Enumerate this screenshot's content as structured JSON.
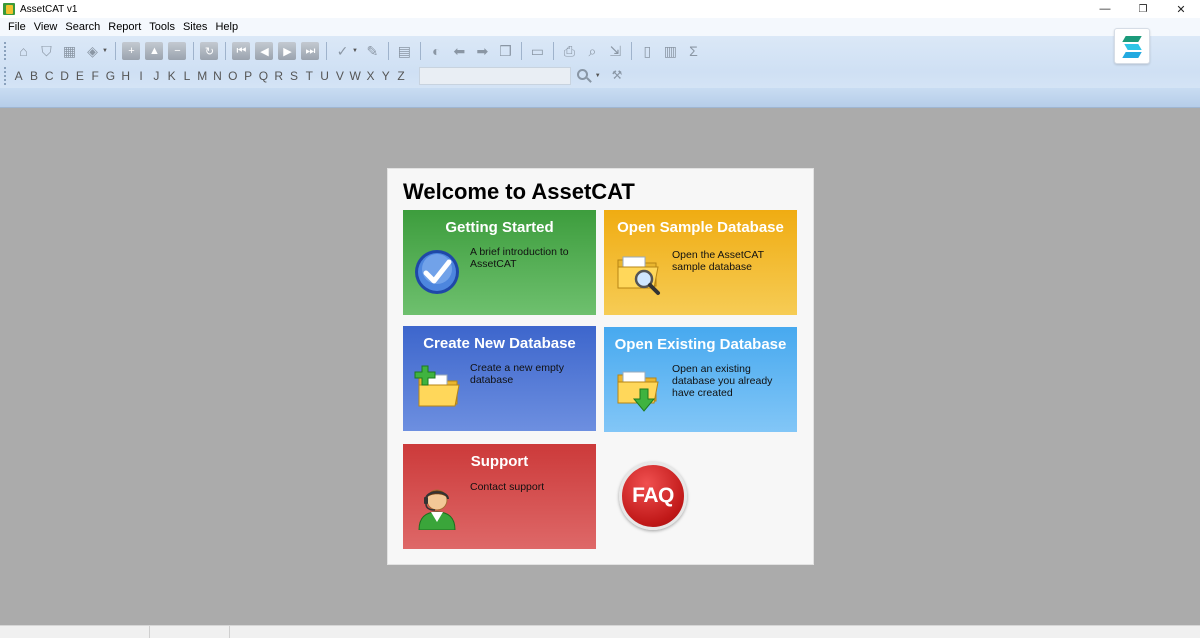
{
  "window": {
    "title": "AssetCAT v1",
    "minimize": "—",
    "restore": "❐",
    "close": "✕"
  },
  "menu": [
    "File",
    "View",
    "Search",
    "Report",
    "Tools",
    "Sites",
    "Help"
  ],
  "alphabet": [
    "A",
    "B",
    "C",
    "D",
    "E",
    "F",
    "G",
    "H",
    "I",
    "J",
    "K",
    "L",
    "M",
    "N",
    "O",
    "P",
    "Q",
    "R",
    "S",
    "T",
    "U",
    "V",
    "W",
    "X",
    "Y",
    "Z"
  ],
  "toolbar": {
    "sigma": "Σ"
  },
  "welcome": {
    "title": "Welcome to AssetCAT",
    "tiles": [
      {
        "title": "Getting Started",
        "desc": "A brief introduction to AssetCAT",
        "icon": "checkmark-icon",
        "color": "#3d9d3d"
      },
      {
        "title": "Open Sample Database",
        "desc": "Open the AssetCAT sample database",
        "icon": "folder-search-icon",
        "color": "#f0ac12"
      },
      {
        "title": "Create New Database",
        "desc": "Create a new empty database",
        "icon": "folder-add-icon",
        "color": "#3d66cc"
      },
      {
        "title": "Open Existing Database",
        "desc": "Open an existing database you already have created",
        "icon": "folder-open-icon",
        "color": "#47a9ef"
      },
      {
        "title": "Support",
        "desc": "Contact support",
        "icon": "support-agent-icon",
        "color": "#cc3a3a"
      }
    ],
    "faq": "FAQ"
  }
}
